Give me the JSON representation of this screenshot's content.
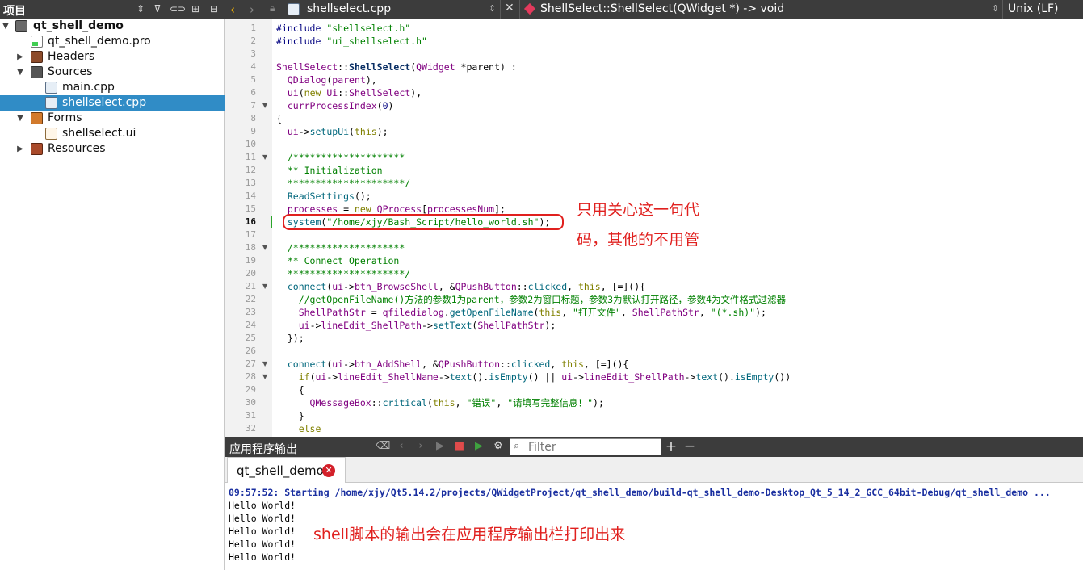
{
  "project_pane": {
    "title": "项目",
    "tree": [
      {
        "label": "qt_shell_demo",
        "depth": 0,
        "expanded": true,
        "bold": true,
        "icon": "project-icon"
      },
      {
        "label": "qt_shell_demo.pro",
        "depth": 1,
        "icon": "pro-file-icon"
      },
      {
        "label": "Headers",
        "depth": 1,
        "collapsed": true,
        "icon": "headers-folder-icon"
      },
      {
        "label": "Sources",
        "depth": 1,
        "expanded": true,
        "icon": "sources-folder-icon"
      },
      {
        "label": "main.cpp",
        "depth": 2,
        "icon": "cpp-file-icon"
      },
      {
        "label": "shellselect.cpp",
        "depth": 2,
        "selected": true,
        "icon": "cpp-file-icon"
      },
      {
        "label": "Forms",
        "depth": 1,
        "expanded": true,
        "icon": "forms-folder-icon"
      },
      {
        "label": "shellselect.ui",
        "depth": 2,
        "icon": "ui-file-icon"
      },
      {
        "label": "Resources",
        "depth": 1,
        "collapsed": true,
        "icon": "resources-folder-icon"
      }
    ]
  },
  "editor_toolbar": {
    "file_name": "shellselect.cpp",
    "symbol": "ShellSelect::ShellSelect(QWidget *) -> void",
    "line_ending": "Unix (LF)"
  },
  "editor": {
    "current_line": 16,
    "lines": [
      "1",
      "2",
      "3",
      "4",
      "5",
      "6",
      "7",
      "8",
      "9",
      "10",
      "11",
      "12",
      "13",
      "14",
      "15",
      "16",
      "17",
      "18",
      "19",
      "20",
      "21",
      "22",
      "23",
      "24",
      "25",
      "26",
      "27",
      "28",
      "29",
      "30",
      "31",
      "32"
    ]
  },
  "annotations": {
    "code_note_line1": "只用关心这一句代",
    "code_note_line2": "码，其他的不用管",
    "output_note": "shell脚本的输出会在应用程序输出栏打印出来"
  },
  "output_pane": {
    "title": "应用程序输出",
    "filter_placeholder": "Filter",
    "tab_label": "qt_shell_demo",
    "lines": [
      "09:57:52: Starting /home/xjy/Qt5.14.2/projects/QWidgetProject/qt_shell_demo/build-qt_shell_demo-Desktop_Qt_5_14_2_GCC_64bit-Debug/qt_shell_demo ...",
      "Hello World!",
      "Hello World!",
      "Hello World!",
      "Hello World!",
      "Hello World!"
    ]
  },
  "colors": {
    "toolbar_bg": "#3c3c3c",
    "selection": "#308cc6",
    "annotation_red": "#e0201e"
  }
}
